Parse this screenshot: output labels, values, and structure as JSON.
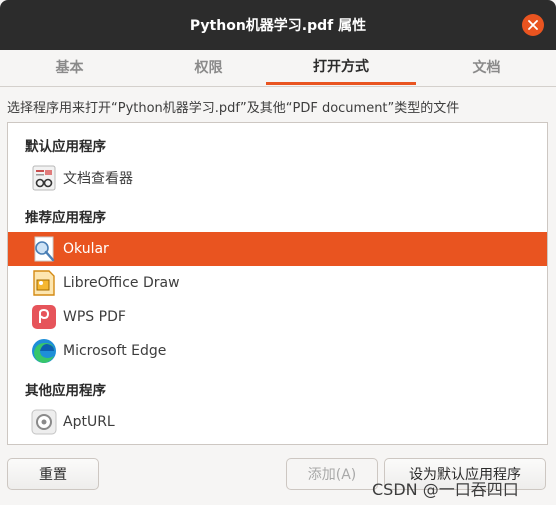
{
  "window": {
    "title": "Python机器学习.pdf 属性",
    "close_icon": "close-icon"
  },
  "tabs": [
    {
      "label": "基本"
    },
    {
      "label": "权限"
    },
    {
      "label": "打开方式"
    },
    {
      "label": "文档"
    }
  ],
  "active_tab": "打开方式",
  "description": "选择程序用来打开“Python机器学习.pdf”及其他“PDF document”类型的文件",
  "sections": {
    "default": {
      "heading": "默认应用程序",
      "apps": [
        {
          "name": "文档查看器",
          "icon": "document-viewer-icon"
        }
      ]
    },
    "recommended": {
      "heading": "推荐应用程序",
      "apps": [
        {
          "name": "Okular",
          "icon": "okular-icon",
          "selected": true
        },
        {
          "name": "LibreOffice Draw",
          "icon": "libreoffice-draw-icon"
        },
        {
          "name": "WPS PDF",
          "icon": "wps-pdf-icon"
        },
        {
          "name": "Microsoft Edge",
          "icon": "microsoft-edge-icon"
        }
      ]
    },
    "other": {
      "heading": "其他应用程序",
      "apps": [
        {
          "name": "AptURL",
          "icon": "apturl-icon"
        }
      ]
    }
  },
  "buttons": {
    "reset": "重置",
    "add": "添加(A)",
    "set_default": "设为默认应用程序"
  },
  "watermark": "CSDN @一口吞四口",
  "colors": {
    "accent": "#e95420",
    "titlebar": "#2c2c2c"
  }
}
